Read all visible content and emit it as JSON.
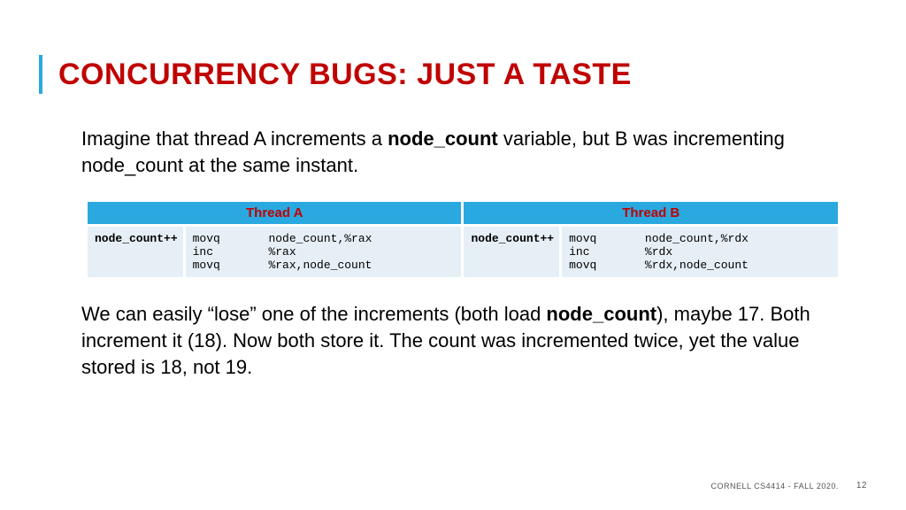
{
  "title": "CONCURRENCY BUGS:  JUST A TASTE",
  "intro_pre": "Imagine that thread A increments a ",
  "intro_bold": "node_count",
  "intro_post": " variable, but B was incrementing node_count at the same instant.",
  "table": {
    "headers": {
      "a": "Thread A",
      "b": "Thread B"
    },
    "a_code": "node_count++",
    "a_asm": "movq       node_count,%rax\ninc        %rax\nmovq       %rax,node_count",
    "b_code": "node_count++",
    "b_asm": "movq       node_count,%rdx\ninc        %rdx\nmovq       %rdx,node_count"
  },
  "explain_pre": "We can easily “lose” one of the increments (both load ",
  "explain_bold": "node_count",
  "explain_post": "), maybe 17.  Both increment it (18).  Now both store it.  The count was incremented twice, yet the value stored is 18, not 19.",
  "footer": {
    "course": "CORNELL CS4414 - FALL 2020.",
    "page": "12"
  }
}
